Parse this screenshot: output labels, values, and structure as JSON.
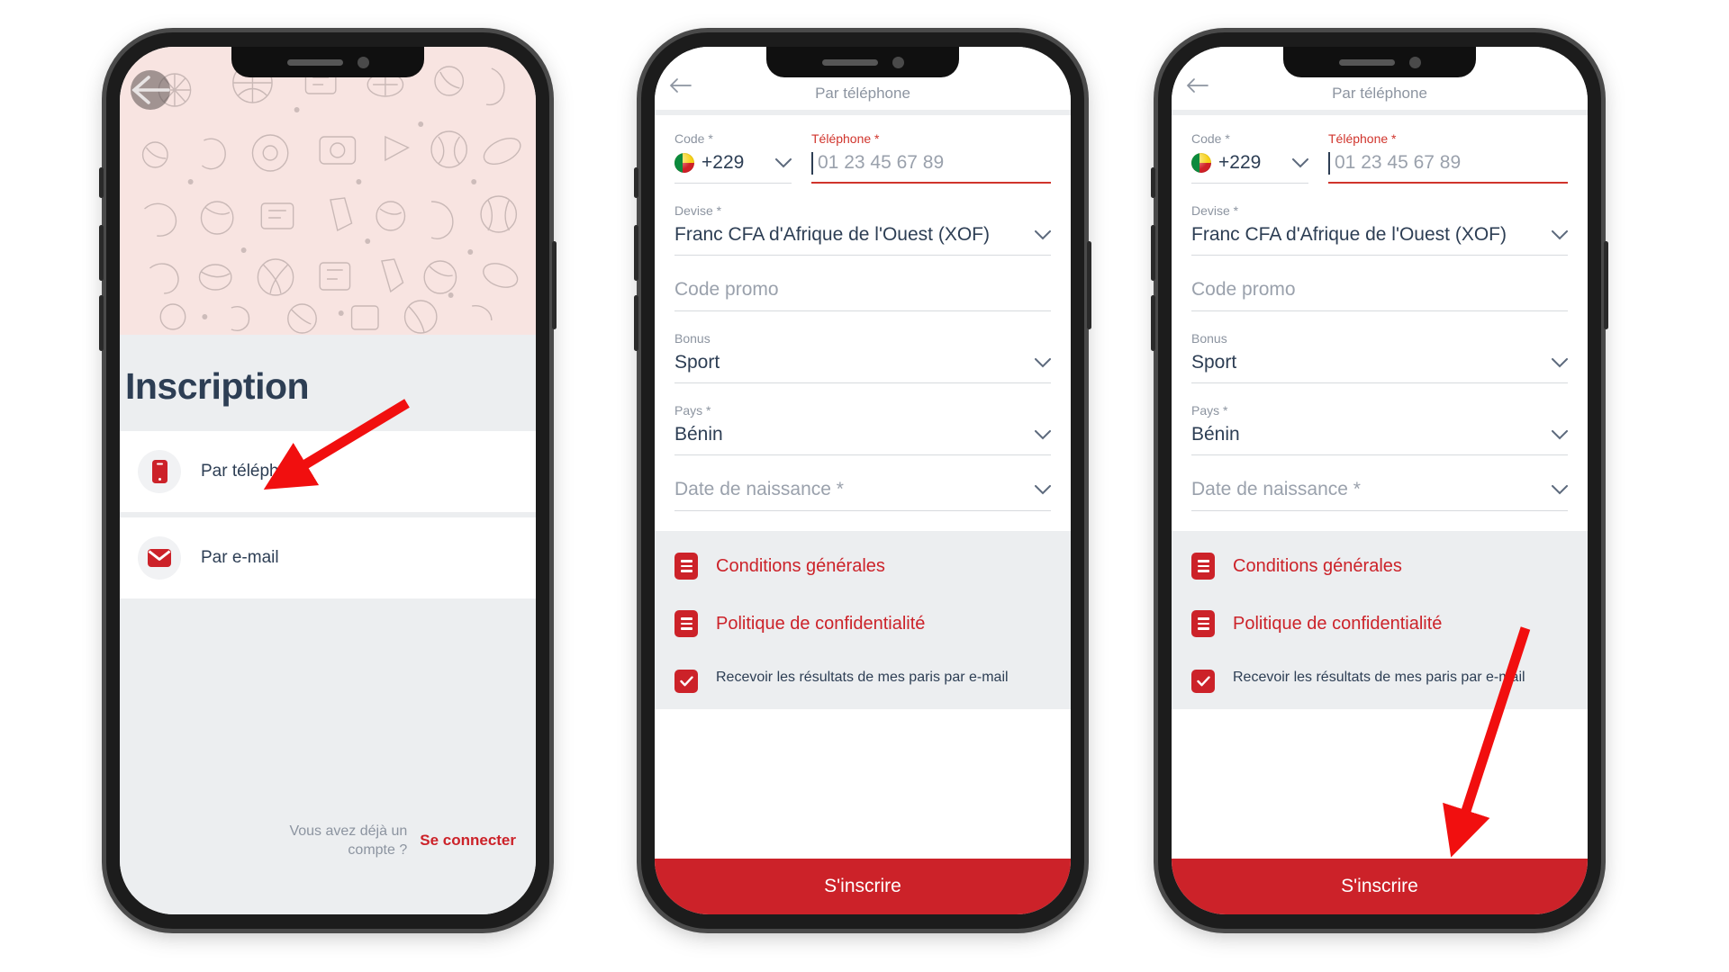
{
  "accent": "#cc2229",
  "navy": "#2d3e54",
  "grey_text": "#8c94a0",
  "screen1": {
    "back_icon": "back-arrow-icon",
    "title": "Inscription",
    "options": [
      {
        "icon": "phone-icon",
        "label": "Par téléphone"
      },
      {
        "icon": "envelope-icon",
        "label": "Par e-mail"
      }
    ],
    "footer_question": "Vous avez déjà un compte ?",
    "footer_link": "Se connecter"
  },
  "screen2": {
    "header_title": "Par téléphone",
    "back_icon": "back-arrow-icon",
    "fields": {
      "code": {
        "label": "Code *",
        "value": "+229",
        "flag": "benin-flag-icon",
        "chevron": "chevron-down-icon"
      },
      "phone": {
        "label": "Téléphone *",
        "placeholder": "01 23 45 67 89",
        "value": "",
        "required_highlight": true
      },
      "currency": {
        "label": "Devise *",
        "value": "Franc CFA d'Afrique de l'Ouest (XOF)",
        "chevron": "chevron-down-icon"
      },
      "promo": {
        "label": "",
        "placeholder": "Code promo",
        "value": ""
      },
      "bonus": {
        "label": "Bonus",
        "value": "Sport",
        "chevron": "chevron-down-icon"
      },
      "country": {
        "label": "Pays *",
        "value": "Bénin",
        "chevron": "chevron-down-icon"
      },
      "birthdate": {
        "label": "",
        "placeholder": "Date de naissance *",
        "value": "",
        "chevron": "chevron-down-icon"
      }
    },
    "links": [
      {
        "icon": "document-icon",
        "label": "Conditions générales"
      },
      {
        "icon": "document-icon",
        "label": "Politique de confidentialité"
      }
    ],
    "checkbox": {
      "checked": true,
      "label": "Recevoir les résultats de mes paris par e-mail"
    },
    "submit_label": "S'inscrire"
  },
  "annotations": [
    {
      "name": "arrow-to-par-telephone",
      "target": "Par téléphone",
      "color": "#f10f0f"
    },
    {
      "name": "arrow-to-sinscrire",
      "target": "S'inscrire",
      "color": "#f10f0f"
    }
  ]
}
